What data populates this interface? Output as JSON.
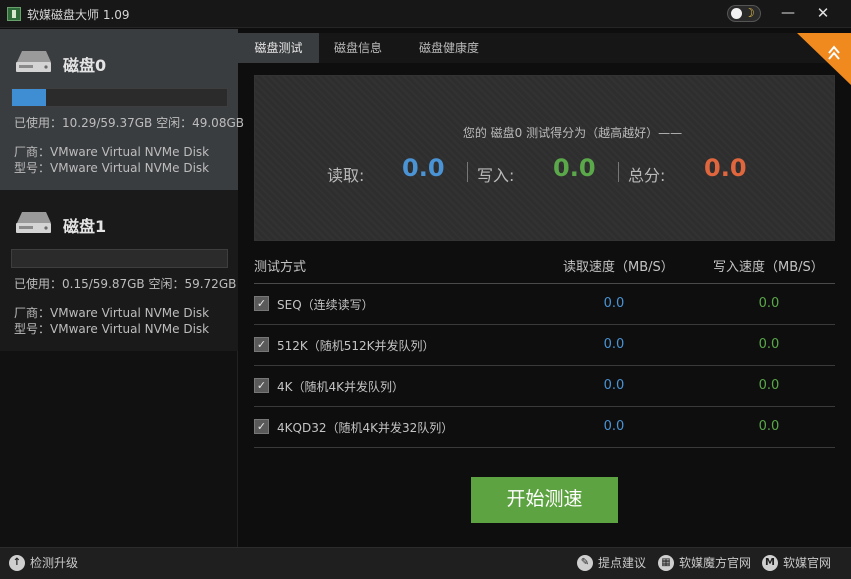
{
  "window": {
    "title": "软媒磁盘大师 1.09",
    "minimize_glyph": "—",
    "close_glyph": "✕",
    "theme_moon_glyph": "☽"
  },
  "sidebar": {
    "disks": [
      {
        "name": "磁盘0",
        "usage_fraction": 0.16,
        "usage_text": "已使用：10.29/59.37GB  空闲：49.08GB",
        "vendor_text": "厂商：VMware Virtual NVMe Disk",
        "model_text": "型号：VMware Virtual NVMe Disk",
        "selected": true,
        "icon": "hard-drive-icon"
      },
      {
        "name": "磁盘1",
        "usage_fraction": 0.0,
        "usage_text": "已使用：0.15/59.87GB  空闲：59.72GB",
        "vendor_text": "厂商：VMware Virtual NVMe Disk",
        "model_text": "型号：VMware Virtual NVMe Disk",
        "selected": false,
        "icon": "hard-drive-icon"
      }
    ]
  },
  "tabs": [
    {
      "label": "磁盘测试",
      "active": true
    },
    {
      "label": "磁盘信息",
      "active": false
    },
    {
      "label": "磁盘健康度",
      "active": false
    }
  ],
  "score": {
    "caption": "您的 磁盘0 测试得分为（越高越好）——",
    "read_label": "读取:",
    "read_value": "0.0",
    "write_label": "写入:",
    "write_value": "0.0",
    "total_label": "总分:",
    "total_value": "0.0",
    "colors": {
      "read": "#4a93d4",
      "write": "#5aa84a",
      "total": "#e0663d"
    }
  },
  "table": {
    "headers": {
      "method": "测试方式",
      "read": "读取速度（MB/S）",
      "write": "写入速度（MB/S）"
    },
    "rows": [
      {
        "label": "SEQ（连续读写）",
        "read": "0.0",
        "write": "0.0",
        "checked": true
      },
      {
        "label": "512K（随机512K并发队列）",
        "read": "0.0",
        "write": "0.0",
        "checked": true
      },
      {
        "label": "4K（随机4K并发队列）",
        "read": "0.0",
        "write": "0.0",
        "checked": true
      },
      {
        "label": "4KQD32（随机4K并发32队列）",
        "read": "0.0",
        "write": "0.0",
        "checked": true
      }
    ],
    "check_glyph": "✓"
  },
  "start_button": {
    "label": "开始测速",
    "color": "#5ea342"
  },
  "footer": {
    "check_update": "检测升级",
    "feedback": "提点建议",
    "cube_site": "软媒魔方官网",
    "ruanmei_site": "软媒官网",
    "update_icon_glyph": "↑",
    "feedback_icon_glyph": "✎",
    "cube_icon_glyph": "▦",
    "ruanmei_icon_glyph": "M"
  },
  "accent_colors": {
    "disk_usage_bar": "#3f8ed4",
    "corner_badge": "#f08a1e"
  }
}
